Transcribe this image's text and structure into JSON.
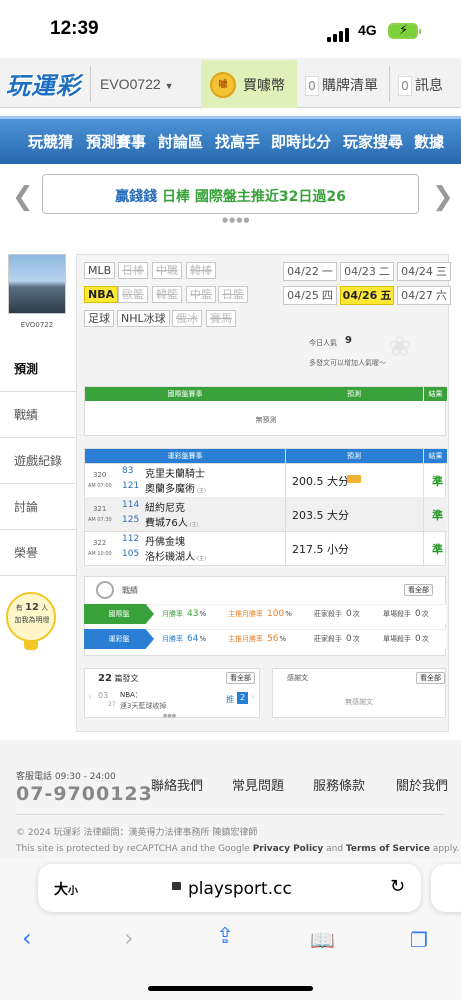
{
  "status_bar": {
    "time": "12:39",
    "network": "4G"
  },
  "top_nav": {
    "logo": "玩運彩",
    "username": "EVO0722",
    "buy_coin": "買噱幣",
    "coin_icon_text": "噱",
    "cart_count": "0",
    "cart_label": "購牌清單",
    "msg_count": "0",
    "msg_label": "訊息"
  },
  "main_menu": [
    "玩競猜",
    "預測賽事",
    "討論區",
    "找高手",
    "即時比分",
    "玩家搜尋",
    "數據"
  ],
  "banner": {
    "part1": "贏錢錢",
    "part2": "日棒 國際盤主推近32日過26",
    "color1": "#2a6fb8",
    "color2": "#39a23a"
  },
  "profile": {
    "username": "EVO0722"
  },
  "sidebar": [
    {
      "label": "預測",
      "active": true
    },
    {
      "label": "戰績",
      "active": false
    },
    {
      "label": "遊戲紀錄",
      "active": false
    },
    {
      "label": "討論",
      "active": false
    },
    {
      "label": "榮譽",
      "active": false
    }
  ],
  "bulb": {
    "prefix": "有",
    "count": "12",
    "suffix": "人",
    "line2": "加我為明燈"
  },
  "leagues_row1": [
    {
      "label": "MLB",
      "state": "normal"
    },
    {
      "label": "日棒",
      "state": "disabled"
    },
    {
      "label": "中職",
      "state": "disabled"
    },
    {
      "label": "韓棒",
      "state": "disabled"
    }
  ],
  "leagues_row2": [
    {
      "label": "NBA",
      "state": "selected"
    },
    {
      "label": "歐籃",
      "state": "disabled"
    },
    {
      "label": "韓籃",
      "state": "disabled"
    },
    {
      "label": "中籃",
      "state": "disabled"
    },
    {
      "label": "日籃",
      "state": "disabled"
    }
  ],
  "leagues_row3": [
    {
      "label": "足球",
      "state": "normal"
    },
    {
      "label": "NHL冰球",
      "state": "normal"
    },
    {
      "label": "俄冰",
      "state": "disabled"
    },
    {
      "label": "賽馬",
      "state": "disabled"
    }
  ],
  "dates": [
    {
      "date": "04/22",
      "day": "一",
      "selected": false
    },
    {
      "date": "04/23",
      "day": "二",
      "selected": false
    },
    {
      "date": "04/24",
      "day": "三",
      "selected": false
    },
    {
      "date": "04/25",
      "day": "四",
      "selected": false
    },
    {
      "date": "04/26",
      "day": "五",
      "selected": true
    },
    {
      "date": "04/27",
      "day": "六",
      "selected": false
    }
  ],
  "popularity": {
    "label": "今日人氣",
    "value": "9",
    "tip": "多發文可以增加人氣喔～"
  },
  "intl_table": {
    "header_game": "國際盤賽事",
    "header_pred": "預測",
    "header_result": "結果",
    "empty": "無預測",
    "color": "#39a23a"
  },
  "sport_table": {
    "header_game": "運彩盤賽事",
    "header_pred": "預測",
    "header_result": "結果",
    "color": "#2a7fd4",
    "rows": [
      {
        "no": "320",
        "time": "AM 07:00",
        "away_no": "83",
        "away": "克里夫蘭騎士",
        "home_no": "121",
        "home": "奧蘭多魔術",
        "home_tag": "(主)",
        "pick": "200.5 大分",
        "result": "準"
      },
      {
        "no": "321",
        "time": "AM 07:30",
        "away_no": "114",
        "away": "紐約尼克",
        "home_no": "125",
        "home": "費城76人",
        "home_tag": "(主)",
        "pick": "203.5 大分",
        "result": "準"
      },
      {
        "no": "322",
        "time": "AM 10:00",
        "away_no": "112",
        "away": "丹佛金塊",
        "home_no": "105",
        "home": "洛杉磯湖人",
        "home_tag": "(主)",
        "pick": "217.5 小分",
        "result": "準"
      }
    ]
  },
  "record": {
    "title": "戰績",
    "view_all": "看全部",
    "rows": [
      {
        "tag": "國際盤",
        "color": "#39a23a",
        "monthly_label": "月勝率",
        "monthly": "43",
        "main_label": "主推月勝率",
        "main": "100",
        "killer_label": "莊家殺手",
        "killer": "0",
        "killer_unit": "次",
        "single_label": "單場殺手",
        "single": "0",
        "single_unit": "次"
      },
      {
        "tag": "運彩盤",
        "color": "#2a7fd4",
        "monthly_label": "月勝率",
        "monthly": "64",
        "main_label": "主推月勝率",
        "main": "56",
        "killer_label": "莊家殺手",
        "killer": "0",
        "killer_unit": "次",
        "single_label": "單場殺手",
        "single": "0",
        "single_unit": "次"
      }
    ]
  },
  "posts": {
    "count": "22",
    "label": "篇發文",
    "view_all": "看全部",
    "date_month": "03",
    "date_day": "27",
    "category": "NBA：",
    "title": "連3天藍球收掉",
    "push_label": "推",
    "push_count": "2"
  },
  "thanks": {
    "label": "感謝文",
    "view_all": "看全部",
    "empty": "無感謝文"
  },
  "footer": {
    "service_label": "客服電話 09:30 - 24:00",
    "phone": "07-9700123",
    "links": [
      "聯絡我們",
      "常見問題",
      "服務條款",
      "關於我們"
    ],
    "copyright": "© 2024 玩運彩 法律顧問：漢英得力法律事務所 陳鎮宏律師",
    "recaptcha_pre": "This site is protected by reCAPTCHA and the Google",
    "privacy": "Privacy Policy",
    "and": "and",
    "terms": "Terms of Service",
    "apply": "apply."
  },
  "safari": {
    "aa_big": "大",
    "aa_small": "小",
    "url": "playsport.cc"
  }
}
